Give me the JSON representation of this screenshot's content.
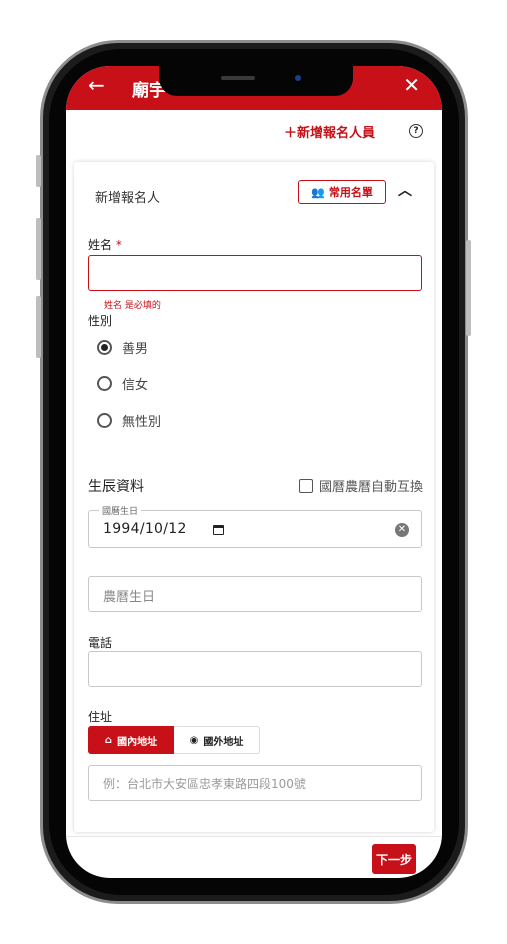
{
  "header": {
    "title": "廟宇",
    "back_icon": "arrow-left-icon",
    "close_icon": "close-icon"
  },
  "toolbar": {
    "add_person_label": "＋新增報名人員",
    "help_icon": "help-circle-icon"
  },
  "card": {
    "title": "新增報名人",
    "common_list_label": "常用名單",
    "common_list_icon": "people-icon",
    "collapse_icon": "chevron-up-icon"
  },
  "form": {
    "name": {
      "label": "姓名",
      "required_mark": "*",
      "value": "",
      "error": "姓名 是必填的"
    },
    "gender": {
      "label": "性別",
      "options": [
        "善男",
        "信女",
        "無性別"
      ],
      "selected": "善男"
    },
    "birth_section": {
      "title": "生辰資料",
      "lunar_toggle_label": "國曆農曆自動互換",
      "lunar_toggle_checked": false
    },
    "solar_birthday": {
      "legend": "國曆生日",
      "value": "1994/10/12",
      "calendar_icon": "calendar-icon",
      "clear_icon": "clear-icon"
    },
    "lunar_birthday": {
      "placeholder": "農曆生日",
      "value": ""
    },
    "phone": {
      "label": "電話",
      "value": ""
    },
    "address": {
      "label": "住址",
      "tabs": [
        {
          "label": "國內地址",
          "icon": "home-icon",
          "active": true
        },
        {
          "label": "國外地址",
          "icon": "globe-icon",
          "active": false
        }
      ],
      "placeholder": "例：台北市大安區忠孝東路四段100號",
      "value": ""
    }
  },
  "footer": {
    "next_label": "下一步"
  },
  "colors": {
    "brand_red": "#c71018",
    "error_red": "#c71018"
  }
}
